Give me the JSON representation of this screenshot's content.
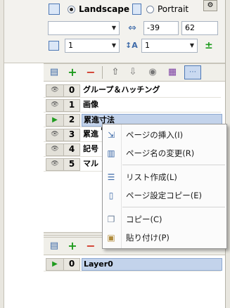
{
  "orientation": {
    "landscape_label": "Landscape",
    "portrait_label": "Portrait",
    "selected": "Landscape"
  },
  "offset": {
    "x_value": "-39",
    "y_value": "62"
  },
  "page_size": {
    "value": "1"
  },
  "scale": {
    "value": "1"
  },
  "pages": [
    {
      "index": "0",
      "name": "グループ＆ハッチング",
      "selected": false
    },
    {
      "index": "1",
      "name": "画像",
      "selected": false
    },
    {
      "index": "2",
      "name": "累進寸法",
      "selected": true
    },
    {
      "index": "3",
      "name": "累進",
      "selected": false
    },
    {
      "index": "4",
      "name": "記号",
      "selected": false
    },
    {
      "index": "5",
      "name": "マル",
      "selected": false
    }
  ],
  "context_menu": {
    "items": [
      {
        "label": "ページの挿入(I)",
        "icon": "insert-page-icon"
      },
      {
        "label": "ページ名の変更(R)",
        "icon": "rename-page-icon"
      },
      {
        "label": "リスト作成(L)",
        "icon": "list-icon"
      },
      {
        "label": "ページ設定コピー(E)",
        "icon": "copy-settings-icon"
      },
      {
        "label": "コピー(C)",
        "icon": "copy-icon"
      },
      {
        "label": "貼り付け(P)",
        "icon": "paste-icon"
      }
    ]
  },
  "layers": [
    {
      "index": "0",
      "name": "Layer0",
      "selected": true
    }
  ],
  "colors": {
    "selection": "#c3d3eb",
    "accent_green": "#1e9b1e",
    "accent_red": "#d23b2c"
  }
}
